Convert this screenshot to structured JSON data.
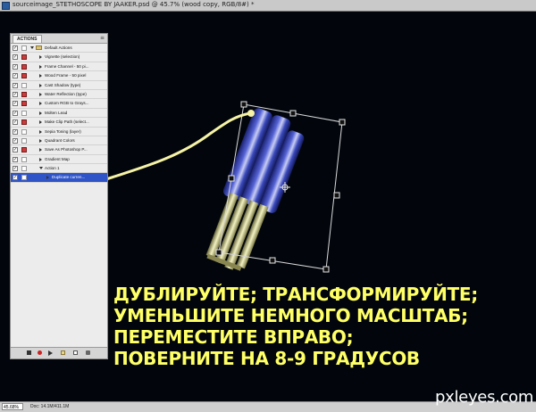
{
  "window": {
    "title": "sourceimage_STETHOSCOPE BY JAAKER.psd @ 45.7% (wood copy, RGB/8#) *"
  },
  "actions_panel": {
    "tab_label": "ACTIONS",
    "rows": [
      {
        "label": "Default Actions",
        "checked": true,
        "dialog": false,
        "type": "set",
        "expanded": true,
        "selected": false
      },
      {
        "label": "Vignette (selection)",
        "checked": true,
        "dialog": true,
        "type": "action",
        "expanded": false,
        "selected": false
      },
      {
        "label": "Frame Channel - 50 pi...",
        "checked": true,
        "dialog": true,
        "type": "action",
        "expanded": false,
        "selected": false
      },
      {
        "label": "Wood Frame - 50 pixel",
        "checked": true,
        "dialog": true,
        "type": "action",
        "expanded": false,
        "selected": false
      },
      {
        "label": "Cast Shadow (type)",
        "checked": true,
        "dialog": false,
        "type": "action",
        "expanded": false,
        "selected": false
      },
      {
        "label": "Water Reflection (type)",
        "checked": true,
        "dialog": true,
        "type": "action",
        "expanded": false,
        "selected": false
      },
      {
        "label": "Custom RGB to Grays...",
        "checked": true,
        "dialog": true,
        "type": "action",
        "expanded": false,
        "selected": false
      },
      {
        "label": "Molten Lead",
        "checked": true,
        "dialog": false,
        "type": "action",
        "expanded": false,
        "selected": false
      },
      {
        "label": "Make Clip Path (select...",
        "checked": true,
        "dialog": true,
        "type": "action",
        "expanded": false,
        "selected": false
      },
      {
        "label": "Sepia Toning (layer)",
        "checked": true,
        "dialog": false,
        "type": "action",
        "expanded": false,
        "selected": false
      },
      {
        "label": "Quadrant Colors",
        "checked": true,
        "dialog": false,
        "type": "action",
        "expanded": false,
        "selected": false
      },
      {
        "label": "Save As Photoshop P...",
        "checked": true,
        "dialog": true,
        "type": "action",
        "expanded": false,
        "selected": false
      },
      {
        "label": "Gradient Map",
        "checked": true,
        "dialog": false,
        "type": "action",
        "expanded": false,
        "selected": false
      },
      {
        "label": "Action 1",
        "checked": true,
        "dialog": false,
        "type": "action",
        "expanded": true,
        "selected": false
      },
      {
        "label": "Duplicate curren...",
        "checked": true,
        "dialog": false,
        "type": "step",
        "expanded": false,
        "selected": true
      }
    ]
  },
  "status_bar": {
    "zoom": "45.68%",
    "doc_info": "Doc: 14.1M/411.1M"
  },
  "instructions": {
    "lines": [
      "ДУБЛИРУЙТЕ; ТРАНСФОРМИРУЙТЕ;",
      "УМЕНЬШИТЕ НЕМНОГО МАСШТАБ;",
      "ПЕРЕМЕСТИТЕ ВПРАВО;",
      "ПОВЕРНИТЕ НА 8-9 ГРАДУСОВ"
    ],
    "color": "#ffff66"
  },
  "watermark": "pxleyes.com",
  "colors": {
    "canvas": "#02060c",
    "selection": "#2f54c8",
    "arrow": "#f6f3a6",
    "object_blue": "#2a3aa8"
  }
}
